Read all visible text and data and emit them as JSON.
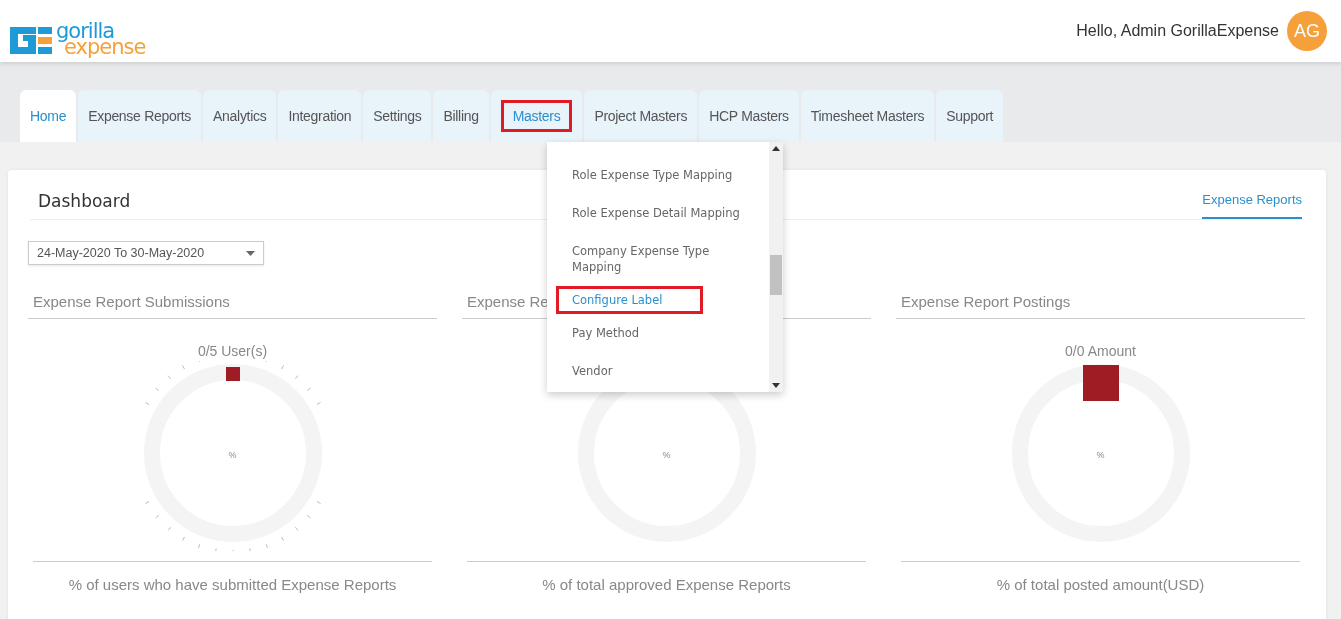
{
  "header": {
    "brand": {
      "line_1": "gorilla",
      "line_2": "expense"
    },
    "greeting": "Hello, Admin GorillaExpense",
    "avatar": "AG"
  },
  "tabs": [
    {
      "label": "Home",
      "selected": true,
      "highlighted": false
    },
    {
      "label": "Expense Reports",
      "selected": false,
      "highlighted": false
    },
    {
      "label": "Analytics",
      "selected": false,
      "highlighted": false
    },
    {
      "label": "Integration",
      "selected": false,
      "highlighted": false
    },
    {
      "label": "Settings",
      "selected": false,
      "highlighted": false
    },
    {
      "label": "Billing",
      "selected": false,
      "highlighted": false
    },
    {
      "label": "Masters",
      "selected": false,
      "highlighted": true
    },
    {
      "label": "Project Masters",
      "selected": false,
      "highlighted": false
    },
    {
      "label": "HCP Masters",
      "selected": false,
      "highlighted": false
    },
    {
      "label": "Timesheet Masters",
      "selected": false,
      "highlighted": false
    },
    {
      "label": "Support",
      "selected": false,
      "highlighted": false
    }
  ],
  "masters_menu": {
    "items": [
      {
        "label": "Role Expense Type Mapping",
        "selected": false,
        "highlighted": false
      },
      {
        "label": "Role Expense Detail Mapping",
        "selected": false,
        "highlighted": false
      },
      {
        "label": "Company Expense Type Mapping",
        "selected": false,
        "highlighted": false
      },
      {
        "label": "Configure Label",
        "selected": true,
        "highlighted": true
      },
      {
        "label": "Pay Method",
        "selected": false,
        "highlighted": false
      },
      {
        "label": "Vendor",
        "selected": false,
        "highlighted": false
      }
    ]
  },
  "dashboard": {
    "title": "Dashboard",
    "link": "Expense Reports",
    "date_range": "24-May-2020 To 30-May-2020",
    "panels": [
      {
        "title": "Expense Report Submissions",
        "count": "0/5 User(s)",
        "kind": "ticked",
        "marker": true,
        "center": "%",
        "caption": "% of users who have submitted Expense Reports"
      },
      {
        "title": "Expense Re",
        "kind": "plain",
        "marker": false,
        "center": "%",
        "caption": "% of total approved Expense Reports"
      },
      {
        "title": "Expense Report Postings",
        "count": "0/0 Amount",
        "kind": "plain",
        "marker": true,
        "center": "%",
        "caption": "% of total posted amount(USD)"
      }
    ]
  }
}
